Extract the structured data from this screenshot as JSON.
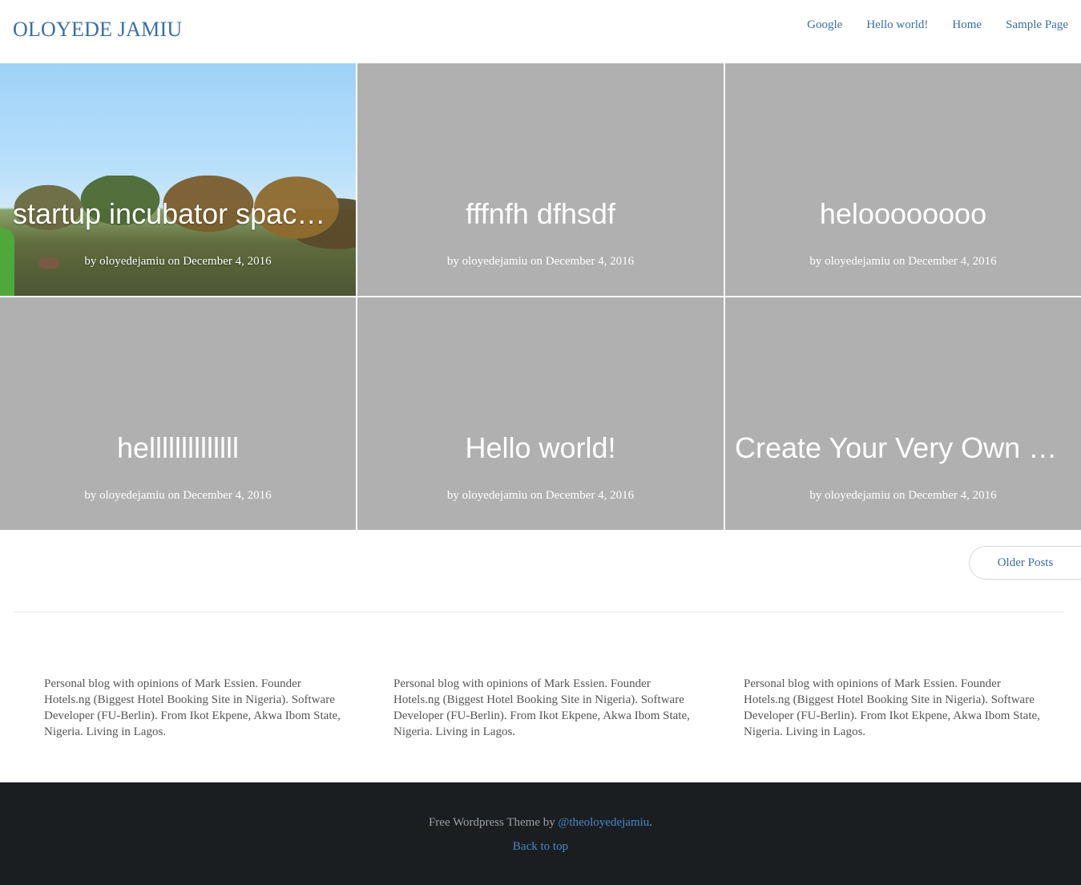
{
  "site": {
    "title": "OLOYEDE JAMIU"
  },
  "nav": {
    "items": [
      {
        "label": "Google"
      },
      {
        "label": "Hello world!"
      },
      {
        "label": "Home"
      },
      {
        "label": "Sample Page"
      }
    ]
  },
  "posts": [
    {
      "title": "startup incubator space in Lagos",
      "by": "by",
      "author": "oloyedejamiu",
      "on": "on",
      "date": "December 4, 2016",
      "has_image": true
    },
    {
      "title": "fffnfh dfhsdf",
      "by": "by",
      "author": "oloyedejamiu",
      "on": "on",
      "date": "December 4, 2016",
      "has_image": false
    },
    {
      "title": "heloooooooo",
      "by": "by",
      "author": "oloyedejamiu",
      "on": "on",
      "date": "December 4, 2016",
      "has_image": false
    },
    {
      "title": "hellllllllllllll",
      "by": "by",
      "author": "oloyedejamiu",
      "on": "on",
      "date": "December 4, 2016",
      "has_image": false
    },
    {
      "title": "Hello world!",
      "by": "by",
      "author": "oloyedejamiu",
      "on": "on",
      "date": "December 4, 2016",
      "has_image": false
    },
    {
      "title": "Create Your Very Own Website",
      "by": "by",
      "author": "oloyedejamiu",
      "on": "on",
      "date": "December 4, 2016",
      "has_image": false
    }
  ],
  "pagination": {
    "older_label": "Older Posts"
  },
  "widgets": [
    {
      "text": "Personal blog with opinions of Mark Essien. Founder Hotels.ng (Biggest Hotel Booking Site in Nigeria). Software Developer (FU-Berlin). From Ikot Ekpene, Akwa Ibom State, Nigeria. Living in Lagos."
    },
    {
      "text": "Personal blog with opinions of Mark Essien. Founder Hotels.ng (Biggest Hotel Booking Site in Nigeria). Software Developer (FU-Berlin). From Ikot Ekpene, Akwa Ibom State, Nigeria. Living in Lagos."
    },
    {
      "text": "Personal blog with opinions of Mark Essien. Founder Hotels.ng (Biggest Hotel Booking Site in Nigeria). Software Developer (FU-Berlin). From Ikot Ekpene, Akwa Ibom State, Nigeria. Living in Lagos."
    }
  ],
  "footer": {
    "credit_prefix": "Free Wordpress Theme by ",
    "credit_link": "@theoloyedejamiu",
    "credit_suffix": ".",
    "back_to_top": "Back to top"
  },
  "colors": {
    "link": "#3a6ea5",
    "tile_gray": "#b0b0b0",
    "footer_bg": "#1b1e21"
  }
}
